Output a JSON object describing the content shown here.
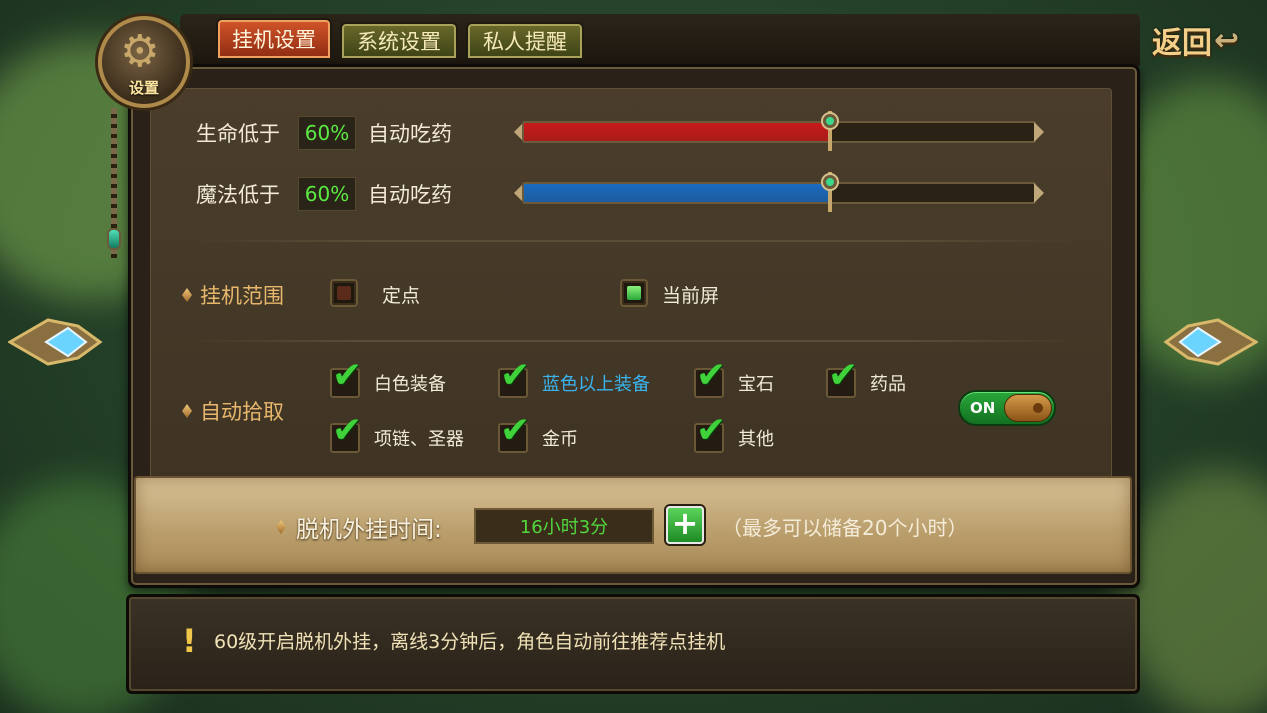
{
  "tabs": [
    {
      "label": "挂机设置",
      "active": true
    },
    {
      "label": "系统设置",
      "active": false
    },
    {
      "label": "私人提醒",
      "active": false
    }
  ],
  "emblem_label": "设置",
  "back_label": "返回",
  "hp": {
    "prefix": "生命低于",
    "percent": "60%",
    "suffix": "自动吃药",
    "level": 0.6,
    "color": "#c81a1a"
  },
  "mp": {
    "prefix": "魔法低于",
    "percent": "60%",
    "suffix": "自动吃药",
    "level": 0.6,
    "color": "#1a6ac0"
  },
  "range": {
    "label": "挂机范围",
    "options": [
      {
        "label": "定点",
        "selected": false
      },
      {
        "label": "当前屏",
        "selected": true
      }
    ]
  },
  "pickup": {
    "label": "自动拾取",
    "items": [
      {
        "label": "白色装备",
        "checked": true,
        "color": "#f2ead6"
      },
      {
        "label": "蓝色以上装备",
        "checked": true,
        "color": "#3ab4f0"
      },
      {
        "label": "宝石",
        "checked": true,
        "color": "#f2ead6"
      },
      {
        "label": "药品",
        "checked": true,
        "color": "#f2ead6"
      },
      {
        "label": "项链、圣器",
        "checked": true,
        "color": "#f2ead6"
      },
      {
        "label": "金币",
        "checked": true,
        "color": "#f2ead6"
      },
      {
        "label": "其他",
        "checked": true,
        "color": "#f2ead6"
      }
    ],
    "toggle": "ON"
  },
  "offline": {
    "label": "脱机外挂时间:",
    "value": "16小时3分",
    "note": "（最多可以储备20个小时）"
  },
  "tip": {
    "icon": "!",
    "text": "60级开启脱机外挂，离线3分钟后，角色自动前往推荐点挂机"
  }
}
